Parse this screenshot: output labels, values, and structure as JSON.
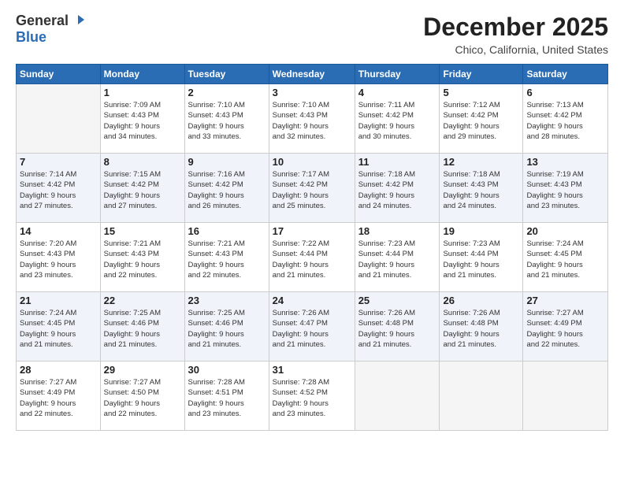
{
  "header": {
    "logo_line1": "General",
    "logo_line2": "Blue",
    "month": "December 2025",
    "location": "Chico, California, United States"
  },
  "weekdays": [
    "Sunday",
    "Monday",
    "Tuesday",
    "Wednesday",
    "Thursday",
    "Friday",
    "Saturday"
  ],
  "weeks": [
    [
      {
        "day": "",
        "info": ""
      },
      {
        "day": "1",
        "info": "Sunrise: 7:09 AM\nSunset: 4:43 PM\nDaylight: 9 hours\nand 34 minutes."
      },
      {
        "day": "2",
        "info": "Sunrise: 7:10 AM\nSunset: 4:43 PM\nDaylight: 9 hours\nand 33 minutes."
      },
      {
        "day": "3",
        "info": "Sunrise: 7:10 AM\nSunset: 4:43 PM\nDaylight: 9 hours\nand 32 minutes."
      },
      {
        "day": "4",
        "info": "Sunrise: 7:11 AM\nSunset: 4:42 PM\nDaylight: 9 hours\nand 30 minutes."
      },
      {
        "day": "5",
        "info": "Sunrise: 7:12 AM\nSunset: 4:42 PM\nDaylight: 9 hours\nand 29 minutes."
      },
      {
        "day": "6",
        "info": "Sunrise: 7:13 AM\nSunset: 4:42 PM\nDaylight: 9 hours\nand 28 minutes."
      }
    ],
    [
      {
        "day": "7",
        "info": "Sunrise: 7:14 AM\nSunset: 4:42 PM\nDaylight: 9 hours\nand 27 minutes."
      },
      {
        "day": "8",
        "info": "Sunrise: 7:15 AM\nSunset: 4:42 PM\nDaylight: 9 hours\nand 27 minutes."
      },
      {
        "day": "9",
        "info": "Sunrise: 7:16 AM\nSunset: 4:42 PM\nDaylight: 9 hours\nand 26 minutes."
      },
      {
        "day": "10",
        "info": "Sunrise: 7:17 AM\nSunset: 4:42 PM\nDaylight: 9 hours\nand 25 minutes."
      },
      {
        "day": "11",
        "info": "Sunrise: 7:18 AM\nSunset: 4:42 PM\nDaylight: 9 hours\nand 24 minutes."
      },
      {
        "day": "12",
        "info": "Sunrise: 7:18 AM\nSunset: 4:43 PM\nDaylight: 9 hours\nand 24 minutes."
      },
      {
        "day": "13",
        "info": "Sunrise: 7:19 AM\nSunset: 4:43 PM\nDaylight: 9 hours\nand 23 minutes."
      }
    ],
    [
      {
        "day": "14",
        "info": "Sunrise: 7:20 AM\nSunset: 4:43 PM\nDaylight: 9 hours\nand 23 minutes."
      },
      {
        "day": "15",
        "info": "Sunrise: 7:21 AM\nSunset: 4:43 PM\nDaylight: 9 hours\nand 22 minutes."
      },
      {
        "day": "16",
        "info": "Sunrise: 7:21 AM\nSunset: 4:43 PM\nDaylight: 9 hours\nand 22 minutes."
      },
      {
        "day": "17",
        "info": "Sunrise: 7:22 AM\nSunset: 4:44 PM\nDaylight: 9 hours\nand 21 minutes."
      },
      {
        "day": "18",
        "info": "Sunrise: 7:23 AM\nSunset: 4:44 PM\nDaylight: 9 hours\nand 21 minutes."
      },
      {
        "day": "19",
        "info": "Sunrise: 7:23 AM\nSunset: 4:44 PM\nDaylight: 9 hours\nand 21 minutes."
      },
      {
        "day": "20",
        "info": "Sunrise: 7:24 AM\nSunset: 4:45 PM\nDaylight: 9 hours\nand 21 minutes."
      }
    ],
    [
      {
        "day": "21",
        "info": "Sunrise: 7:24 AM\nSunset: 4:45 PM\nDaylight: 9 hours\nand 21 minutes."
      },
      {
        "day": "22",
        "info": "Sunrise: 7:25 AM\nSunset: 4:46 PM\nDaylight: 9 hours\nand 21 minutes."
      },
      {
        "day": "23",
        "info": "Sunrise: 7:25 AM\nSunset: 4:46 PM\nDaylight: 9 hours\nand 21 minutes."
      },
      {
        "day": "24",
        "info": "Sunrise: 7:26 AM\nSunset: 4:47 PM\nDaylight: 9 hours\nand 21 minutes."
      },
      {
        "day": "25",
        "info": "Sunrise: 7:26 AM\nSunset: 4:48 PM\nDaylight: 9 hours\nand 21 minutes."
      },
      {
        "day": "26",
        "info": "Sunrise: 7:26 AM\nSunset: 4:48 PM\nDaylight: 9 hours\nand 21 minutes."
      },
      {
        "day": "27",
        "info": "Sunrise: 7:27 AM\nSunset: 4:49 PM\nDaylight: 9 hours\nand 22 minutes."
      }
    ],
    [
      {
        "day": "28",
        "info": "Sunrise: 7:27 AM\nSunset: 4:49 PM\nDaylight: 9 hours\nand 22 minutes."
      },
      {
        "day": "29",
        "info": "Sunrise: 7:27 AM\nSunset: 4:50 PM\nDaylight: 9 hours\nand 22 minutes."
      },
      {
        "day": "30",
        "info": "Sunrise: 7:28 AM\nSunset: 4:51 PM\nDaylight: 9 hours\nand 23 minutes."
      },
      {
        "day": "31",
        "info": "Sunrise: 7:28 AM\nSunset: 4:52 PM\nDaylight: 9 hours\nand 23 minutes."
      },
      {
        "day": "",
        "info": ""
      },
      {
        "day": "",
        "info": ""
      },
      {
        "day": "",
        "info": ""
      }
    ]
  ]
}
